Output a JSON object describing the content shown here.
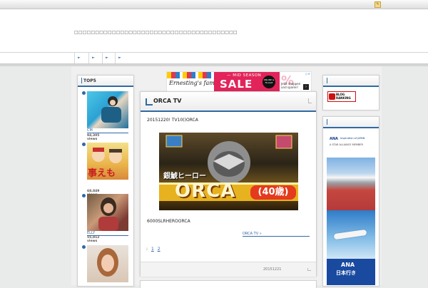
{
  "header": {
    "description": "□□□□□□□□□□□□□□□□□□□□□□□□□□□□□□□□□□□□□□□"
  },
  "nav": {
    "items": [
      {
        "label": "►"
      },
      {
        "label": "►"
      },
      {
        "label": "►"
      },
      {
        "label": "►"
      }
    ]
  },
  "sidebar_left": {
    "title": "TOP5",
    "items": [
      {
        "caption": "CM",
        "views": "94,305 views"
      },
      {
        "caption": "",
        "views": "68,849 views",
        "thumb_text": "事えも"
      },
      {
        "caption": "ELLY",
        "views": "55,812 views"
      },
      {
        "caption": "",
        "views": ""
      }
    ]
  },
  "ad_banner": {
    "brand": "Ernesting's family",
    "headline_small": "— MID SEASON",
    "headline_big": "SALE",
    "badge": "ONLINE & FILIALE",
    "percent": "%",
    "side_text": "Jetzt shoppen und sparen!",
    "arrow": "›",
    "ad_marker": "▷✕"
  },
  "post": {
    "title": "ORCA TV",
    "dateline": "20151220! TV10()ORCA",
    "image_text_top": "銀鯱ヒーロー",
    "image_text_main": "ORCA",
    "image_text_age": "(40歳)",
    "description": "6000SLRHEROORCA",
    "more_link": "ORCA TV »",
    "pager_label": ":",
    "pages": [
      "1",
      "2"
    ],
    "date": "20151221",
    "corner_icon": "⌐"
  },
  "sidebar_right": {
    "badge_text": "BLOG RANKING",
    "ad": {
      "ana_logo": "ANA",
      "tagline": "Inspiration of JAPAN",
      "member": "A STAR ALLIANCE MEMBER",
      "line1": "ANA",
      "line2": "日本行き"
    }
  },
  "colors": {
    "accent": "#2f6aa3",
    "link": "#3568a8",
    "sale": "#e2245a"
  }
}
